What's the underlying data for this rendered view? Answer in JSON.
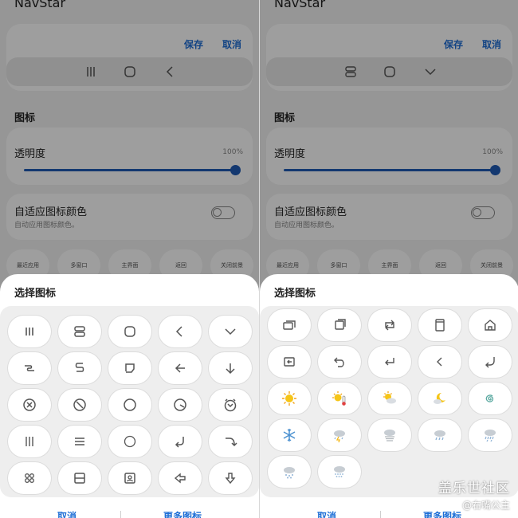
{
  "left": {
    "app_title": "NavStar",
    "save": "保存",
    "cancel": "取消",
    "section_icons": "图标",
    "transparency_label": "透明度",
    "transparency_value": "100%",
    "adaptive_label": "自适应图标颜色",
    "adaptive_sub": "自动应用图标颜色。",
    "pills": [
      "最近应用",
      "多窗口",
      "主界面",
      "返回",
      "关闭前景"
    ],
    "sheet_title": "选择图标",
    "sheet_cancel": "取消",
    "sheet_more": "更多图标",
    "preview_icons": [
      "recents-icon",
      "home-circle-icon",
      "back-icon"
    ],
    "grid_icons": [
      "three-bars-icon",
      "stacked-rects-icon",
      "rounded-square-icon",
      "chevron-left-icon",
      "chevron-down-icon",
      "zigzag-icon",
      "double-s-icon",
      "open-square-icon",
      "arrow-left-icon",
      "arrow-down-icon",
      "circle-x-icon",
      "circle-slash-icon",
      "circle-icon",
      "circle-quarter-icon",
      "circle-v-icon",
      "thin-three-bars-icon",
      "hamburger-icon",
      "thin-circle-icon",
      "return-arrow-icon",
      "curve-arrow-icon",
      "four-dots-icon",
      "split-square-icon",
      "portrait-icon",
      "diamond-arrow-left-icon",
      "diamond-arrow-down-icon"
    ]
  },
  "right": {
    "app_title": "NavStar",
    "save": "保存",
    "cancel": "取消",
    "section_icons": "图标",
    "transparency_label": "透明度",
    "transparency_value": "100%",
    "adaptive_label": "自适应图标颜色",
    "adaptive_sub": "自动应用图标颜色。",
    "pills": [
      "最近应用",
      "多窗口",
      "主界面",
      "返回",
      "关闭前景"
    ],
    "sheet_title": "选择图标",
    "sheet_cancel": "取消",
    "sheet_more": "更多图标",
    "preview_icons": [
      "stacked-rects-icon",
      "home-circle-icon",
      "chevron-down-icon"
    ],
    "grid_icons": [
      "stacked-windows-icon",
      "copy-squares-icon",
      "repeat-arrows-icon",
      "book-icon",
      "house-icon",
      "input-arrow-icon",
      "undo-arrow-icon",
      "return-arrow-icon",
      "chevron-left-icon",
      "return-curve-icon",
      "sun-icon",
      "sun-thermometer-icon",
      "sun-cloud-icon",
      "moon-cloud-icon",
      "spiral-icon",
      "snowflake-icon",
      "cloud-thunder-icon",
      "fog-icon",
      "cloud-rain-icon",
      "cloud-heavy-rain-icon",
      "cloud-snow-icon",
      "cloud-sleet-icon"
    ]
  },
  "watermark": {
    "line1": "盖乐世社区",
    "line2": "@右嘴公主"
  },
  "colors": {
    "accent": "#1f6fd6",
    "slider": "#1f5bb5",
    "sun": "#f5c518"
  }
}
